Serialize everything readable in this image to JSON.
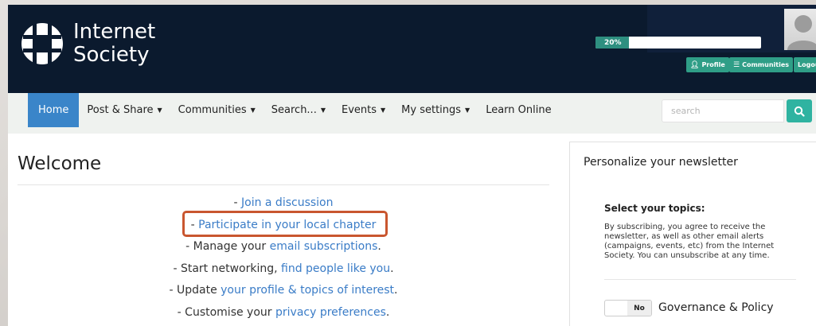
{
  "header": {
    "logo_line1": "Internet",
    "logo_line2": "Society",
    "progress_percent": 20,
    "progress_label": "20%",
    "buttons": [
      {
        "label": "Profile",
        "icon": "user-icon"
      },
      {
        "label": "Communities",
        "icon": "list-icon"
      },
      {
        "label": "Logout",
        "icon": ""
      }
    ]
  },
  "nav": {
    "items": [
      {
        "label": "Home",
        "dropdown": false,
        "active": true
      },
      {
        "label": "Post & Share",
        "dropdown": true
      },
      {
        "label": "Communities",
        "dropdown": true
      },
      {
        "label": "Search...",
        "dropdown": true
      },
      {
        "label": "Events",
        "dropdown": true
      },
      {
        "label": "My settings",
        "dropdown": true
      },
      {
        "label": "Learn Online",
        "dropdown": false
      }
    ],
    "search_placeholder": "search",
    "search_icon": "search-icon"
  },
  "main": {
    "title": "Welcome",
    "lines": [
      {
        "prefix": "- ",
        "link": "Join a discussion",
        "suffix": ""
      },
      {
        "prefix": "- ",
        "link": "Participate in your local chapter",
        "suffix": ""
      },
      {
        "prefix": "- Manage your ",
        "link": "email subscriptions",
        "suffix": "."
      },
      {
        "prefix": "- Start networking, ",
        "link": "find people like you",
        "suffix": "."
      },
      {
        "prefix": "- Update ",
        "link": "your profile & topics of interest",
        "suffix": "."
      },
      {
        "prefix": "- Customise your ",
        "link": "privacy preferences",
        "suffix": "."
      }
    ]
  },
  "sidebar": {
    "title": "Personalize your newsletter",
    "subtitle": "Select your topics:",
    "text": "By subscribing, you agree to receive the newsletter, as well as other email alerts (campaigns, events, etc) from the Internet Society. You can unsubscribe at any time.",
    "toggle_state": "No",
    "toggle_label": "Governance & Policy"
  },
  "colors": {
    "header_bg": "#0b1a2e",
    "accent_blue": "#3a85c9",
    "accent_teal": "#2fb3a1",
    "link": "#3a7cc7",
    "highlight": "#c9562f"
  }
}
